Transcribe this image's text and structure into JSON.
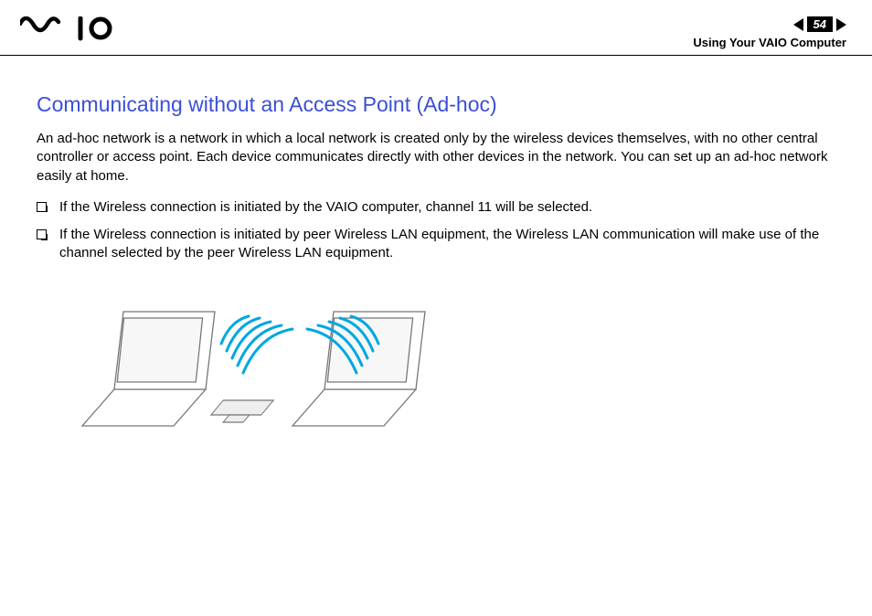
{
  "header": {
    "logo_alt": "VAIO",
    "page_number": "54",
    "breadcrumb": "Using Your VAIO Computer"
  },
  "section": {
    "title": "Communicating without an Access Point (Ad-hoc)",
    "intro": "An ad-hoc network is a network in which a local network is created only by the wireless devices themselves, with no other central controller or access point. Each device communicates directly with other devices in the network. You can set up an ad-hoc network easily at home.",
    "bullets": [
      "If the Wireless connection is initiated by the VAIO computer, channel 11 will be selected.",
      "If the Wireless connection is initiated by peer Wireless LAN equipment, the Wireless LAN communication will make use of the channel selected by the peer Wireless LAN equipment."
    ]
  }
}
